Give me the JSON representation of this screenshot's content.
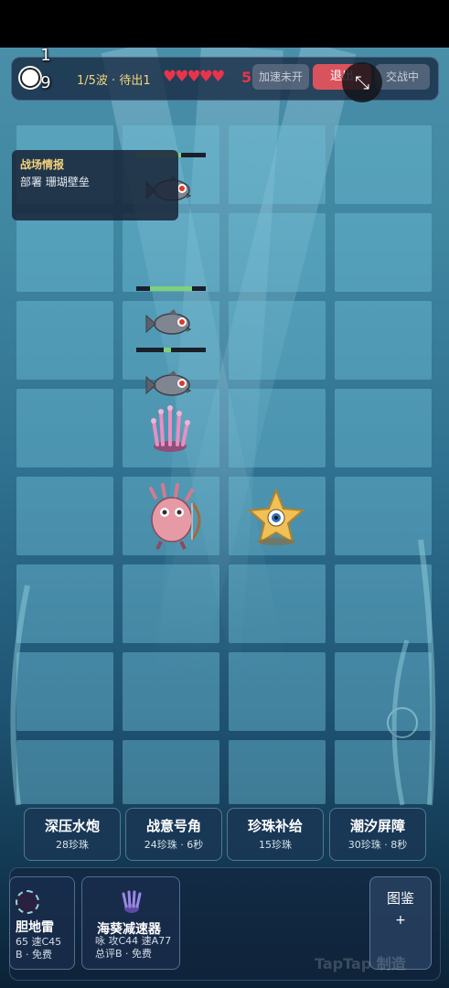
{
  "hud": {
    "gold": "19",
    "wave": "1/5波 · 待出1",
    "hearts": "♥♥♥♥♥",
    "lives": "5",
    "speed_label": "加速未开",
    "exit_label": "退出",
    "battle_label": "交战中",
    "collapse_glyph": "⤡"
  },
  "info": {
    "title": "战场情报",
    "text": "部署 珊瑚壁垒"
  },
  "skills": [
    {
      "name": "深压水炮",
      "cost": "28珍珠"
    },
    {
      "name": "战意号角",
      "cost": "24珍珠 · 6秒"
    },
    {
      "name": "珍珠补给",
      "cost": "15珍珠"
    },
    {
      "name": "潮汐屏障",
      "cost": "30珍珠 · 8秒"
    }
  ],
  "cards": [
    {
      "name": "胆地雷",
      "stats": "65 速C45",
      "grade": "B · 免费"
    },
    {
      "name": "海葵减速器",
      "stats": "咏 攻C44 速A77",
      "grade": "总评B · 免费"
    }
  ],
  "dex": {
    "label": "图鉴",
    "plus": "+"
  },
  "watermark": "TapTap 制造",
  "units": {
    "enemy_hp": [
      0.65,
      0.6,
      0.1
    ]
  }
}
